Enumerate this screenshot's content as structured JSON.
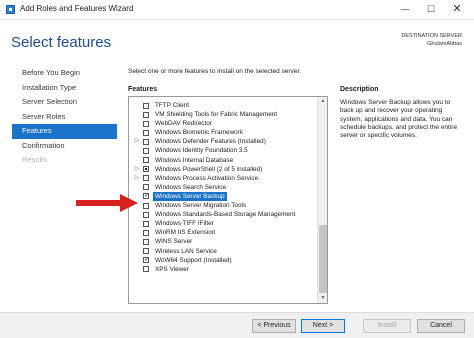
{
  "window": {
    "title": "Add Roles and Features Wizard",
    "minimize_glyph": "—",
    "maximize_glyph": "☐",
    "close_glyph": "✕"
  },
  "header": {
    "page_title": "Select features",
    "destination_label": "DESTINATION SERVER",
    "destination_value": "GhulamAbbas"
  },
  "nav": {
    "items": [
      {
        "label": "Before You Begin",
        "state": "normal"
      },
      {
        "label": "Installation Type",
        "state": "normal"
      },
      {
        "label": "Server Selection",
        "state": "normal"
      },
      {
        "label": "Server Roles",
        "state": "normal"
      },
      {
        "label": "Features",
        "state": "active"
      },
      {
        "label": "Confirmation",
        "state": "normal"
      },
      {
        "label": "Results",
        "state": "disabled"
      }
    ]
  },
  "content": {
    "instruction": "Select one or more features to install on the selected server.",
    "features_label": "Features",
    "description_label": "Description",
    "description_text": "Windows Server Backup allows you to back up and recover your operating system, applications and data. You can schedule backups, and protect the entire server or specific volumes."
  },
  "features": [
    {
      "label": "TFTP Client",
      "check": "none",
      "expander": false
    },
    {
      "label": "VM Shielding Tools for Fabric Management",
      "check": "none",
      "expander": false
    },
    {
      "label": "WebDAV Redirector",
      "check": "none",
      "expander": false
    },
    {
      "label": "Windows Biometric Framework",
      "check": "none",
      "expander": false
    },
    {
      "label": "Windows Defender Features (Installed)",
      "check": "none",
      "expander": true
    },
    {
      "label": "Windows Identity Foundation 3.5",
      "check": "none",
      "expander": false
    },
    {
      "label": "Windows Internal Database",
      "check": "none",
      "expander": false
    },
    {
      "label": "Windows PowerShell (2 of 5 installed)",
      "check": "partial",
      "expander": true
    },
    {
      "label": "Windows Process Activation Service",
      "check": "none",
      "expander": true
    },
    {
      "label": "Windows Search Service",
      "check": "none",
      "expander": false
    },
    {
      "label": "Windows Server Backup",
      "check": "checked",
      "expander": false,
      "selected": true
    },
    {
      "label": "Windows Server Migration Tools",
      "check": "none",
      "expander": false
    },
    {
      "label": "Windows Standards-Based Storage Management",
      "check": "none",
      "expander": false
    },
    {
      "label": "Windows TIFF IFilter",
      "check": "none",
      "expander": false
    },
    {
      "label": "WinRM IIS Extension",
      "check": "none",
      "expander": false
    },
    {
      "label": "WINS Server",
      "check": "none",
      "expander": false
    },
    {
      "label": "Wireless LAN Service",
      "check": "none",
      "expander": false
    },
    {
      "label": "WoW64 Support (Installed)",
      "check": "checked",
      "expander": false
    },
    {
      "label": "XPS Viewer",
      "check": "none",
      "expander": false
    }
  ],
  "scrollbar": {
    "up_glyph": "▲",
    "down_glyph": "▼"
  },
  "footer": {
    "previous_label": "< Previous",
    "next_label": "Next >",
    "install_label": "Install",
    "cancel_label": "Cancel"
  },
  "colors": {
    "accent": "#1a73c9",
    "title_blue": "#1f4e8c",
    "arrow_red": "#d8201c"
  }
}
